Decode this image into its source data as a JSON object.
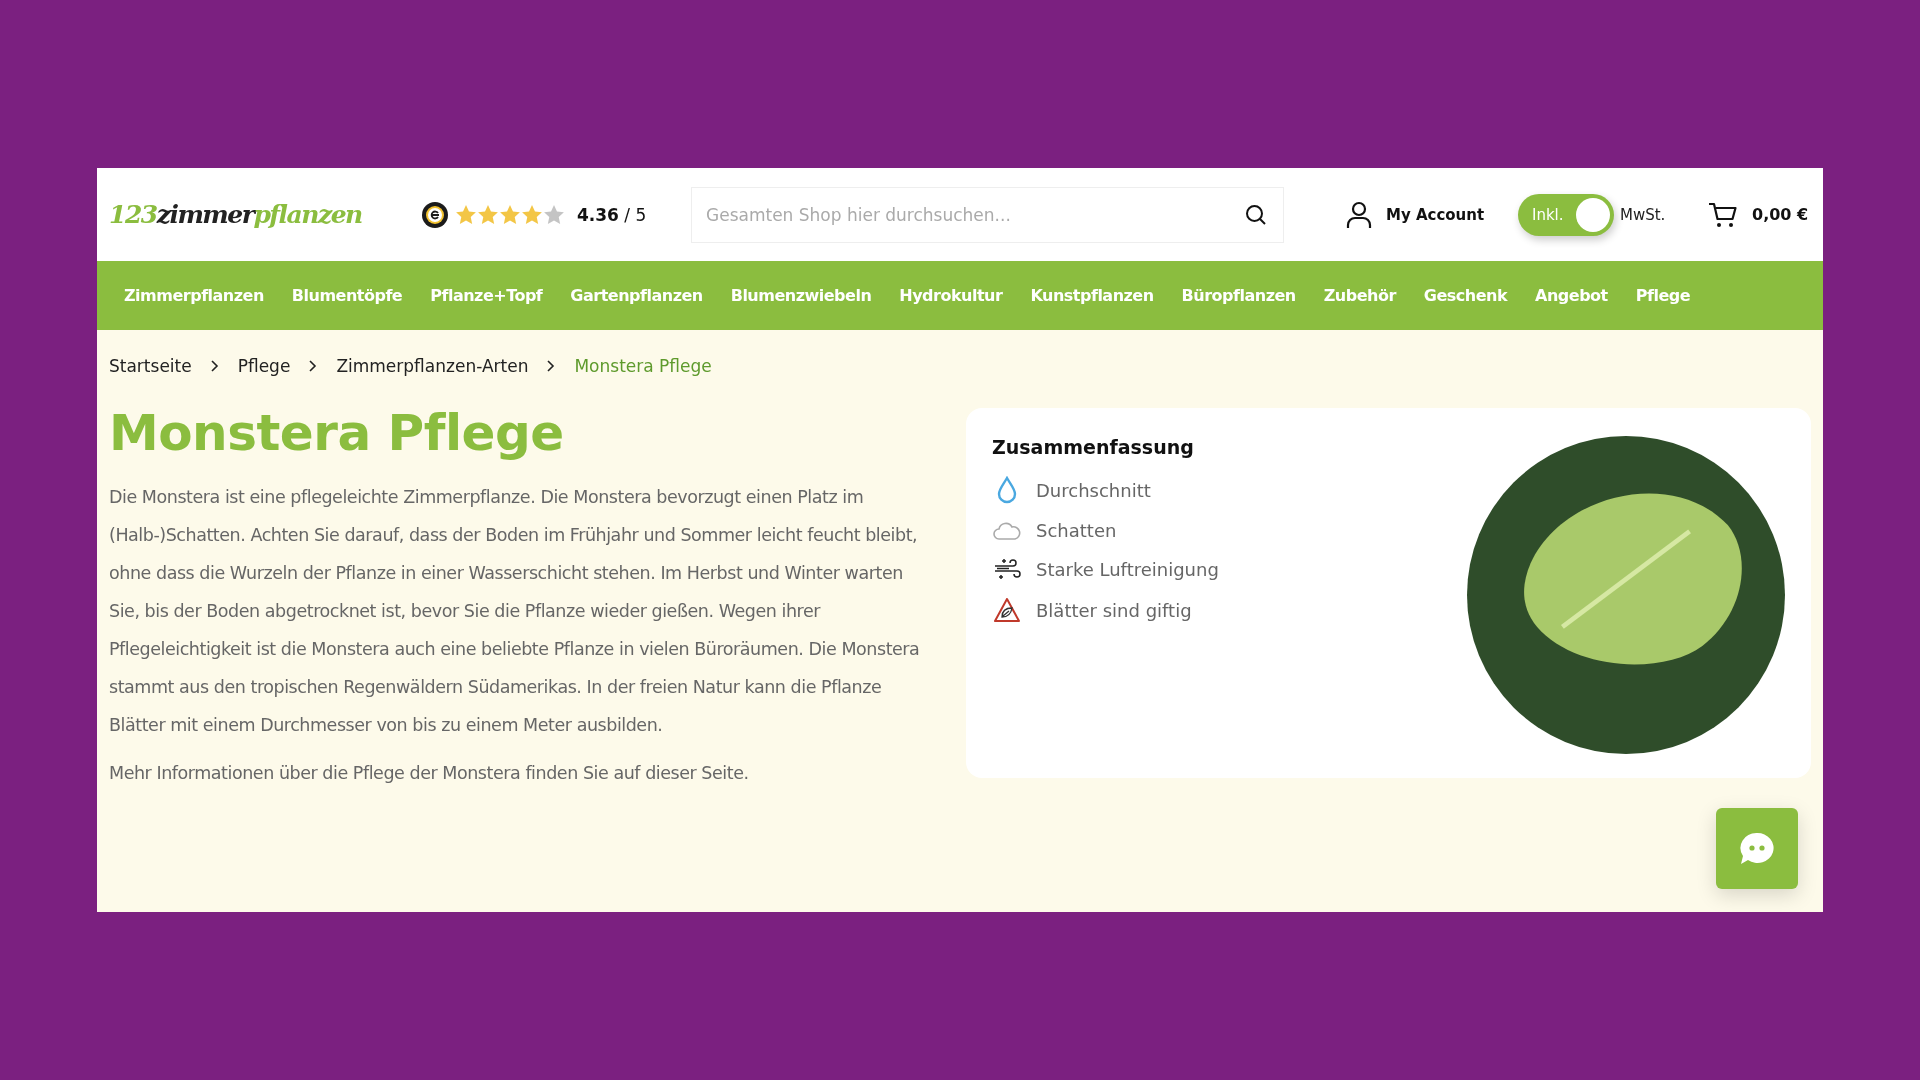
{
  "header": {
    "logo": {
      "part_1": "123",
      "part_2": "zimmer",
      "part_3": "pflanzen"
    },
    "rating": {
      "stars": 4,
      "score": "4.36",
      "scale": "/ 5"
    },
    "search": {
      "placeholder": "Gesamten Shop hier durchsuchen..."
    },
    "account": "My Account",
    "vat_toggle": {
      "on": true,
      "label_on": "Inkl.",
      "label_after": "MwSt."
    },
    "cart_total": "0,00 €"
  },
  "nav": [
    "Zimmerpflanzen",
    "Blumentöpfe",
    "Pflanze+Topf",
    "Gartenpflanzen",
    "Blumenzwiebeln",
    "Hydrokultur",
    "Kunstpflanzen",
    "Büropflanzen",
    "Zubehör",
    "Geschenk",
    "Angebot",
    "Pflege"
  ],
  "breadcrumb": [
    {
      "label": "Startseite",
      "selected": false
    },
    {
      "label": "Pflege",
      "selected": false
    },
    {
      "label": "Zimmerpflanzen-Arten",
      "selected": false
    },
    {
      "label": "Monstera Pflege",
      "selected": true
    }
  ],
  "title": "Monstera Pflege",
  "paragraphs": [
    "Die Monstera ist eine pflegeleichte Zimmerpflanze. Die Monstera bevorzugt einen Platz im (Halb-)Schatten. Achten Sie darauf, dass der Boden im Frühjahr und Sommer leicht feucht bleibt, ohne dass die Wurzeln der Pflanze in einer Wasserschicht stehen. Im Herbst und Winter warten Sie, bis der Boden abgetrocknet ist, bevor Sie die Pflanze wieder gießen. Wegen ihrer Pflegeleichtigkeit ist die Monstera auch eine beliebte Pflanze in vielen Büroräumen. Die Monstera stammt aus den tropischen Regenwäldern Südamerikas. In der freien Natur kann die Pflanze Blätter mit einem Durchmesser von bis zu einem Meter ausbilden.",
    "Mehr Informationen über die Pflege der Monstera finden Sie auf dieser Seite."
  ],
  "summary": {
    "title": "Zusammenfassung",
    "items": [
      {
        "kind": "water",
        "label": "Durchschnitt"
      },
      {
        "kind": "light",
        "label": "Schatten"
      },
      {
        "kind": "air",
        "label": "Starke Luftreinigung"
      },
      {
        "kind": "toxic",
        "label": "Blätter sind giftig"
      }
    ]
  }
}
